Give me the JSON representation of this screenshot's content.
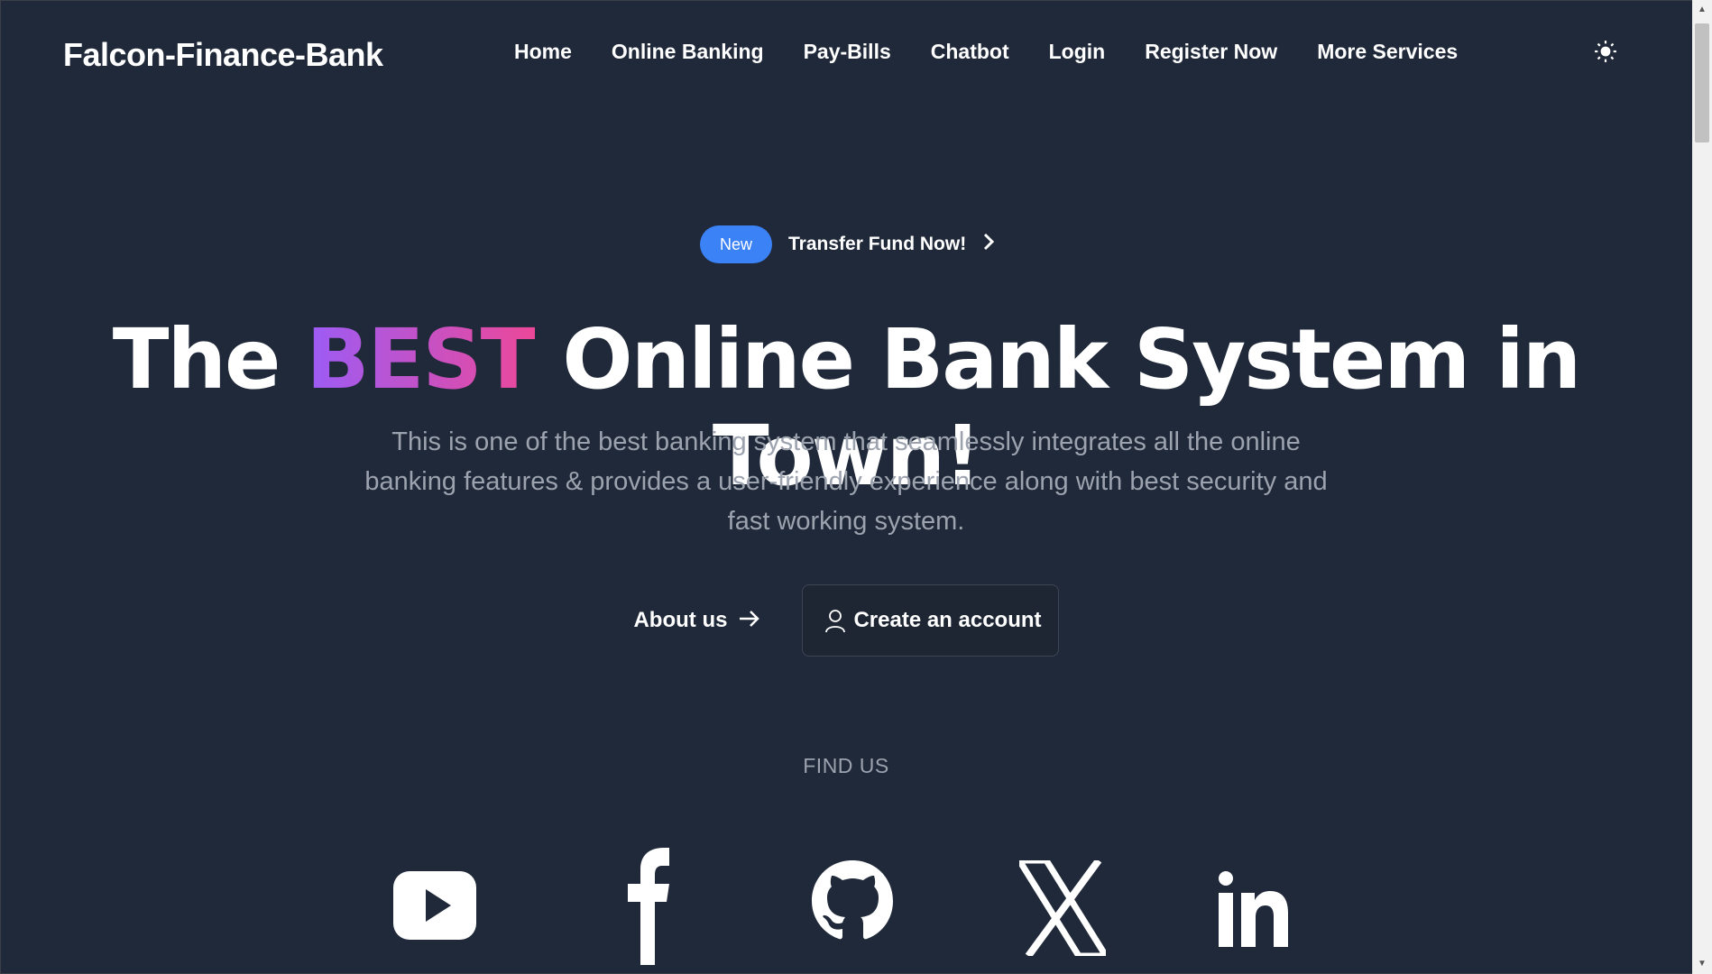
{
  "brand": "Falcon-Finance-Bank",
  "nav": {
    "links": [
      "Home",
      "Online Banking",
      "Pay-Bills",
      "Chatbot",
      "Login",
      "Register Now",
      "More Services"
    ],
    "theme_icon": "sun-icon"
  },
  "announcement": {
    "badge": "New",
    "text": "Transfer Fund Now!",
    "icon": "chevron-right-icon"
  },
  "hero": {
    "title_prefix": "The",
    "title_accent": "BEST",
    "title_suffix": "Online Bank System in Town!",
    "description": "This is one of the best banking system that seamlessly integrates all the online banking features & provides a user-friendly experience along with best security and fast working system.",
    "accent_gradient": [
      "#9b5cf6",
      "#ec4899"
    ]
  },
  "cta": {
    "about_label": "About us",
    "create_label": "Create an account"
  },
  "find_us": {
    "heading": "FIND US",
    "socials": [
      "youtube-icon",
      "facebook-icon",
      "github-icon",
      "x-icon",
      "linkedin-icon"
    ]
  },
  "colors": {
    "background": "#202939",
    "badge": "#3b82f6",
    "muted_text": "#9ca3af"
  }
}
